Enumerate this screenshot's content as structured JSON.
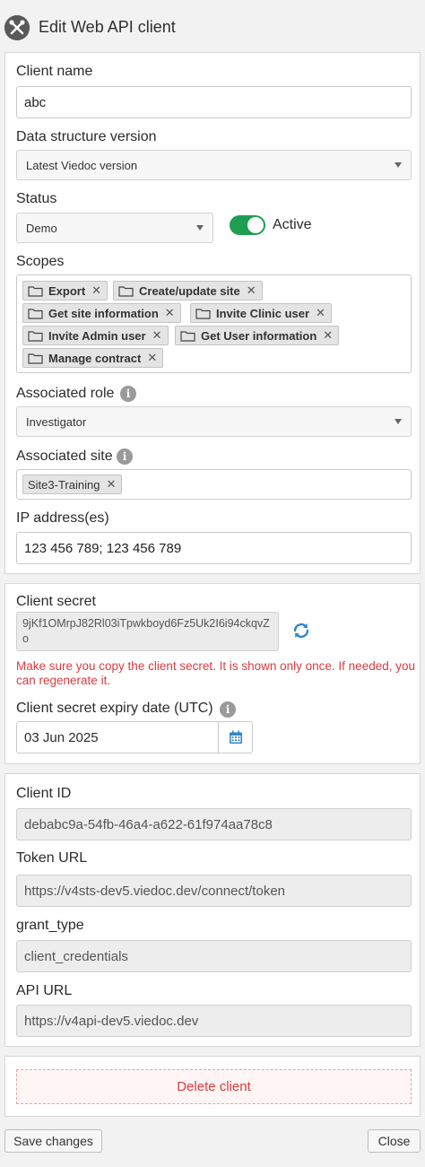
{
  "header": {
    "title": "Edit Web API client",
    "icon": "tools-icon"
  },
  "client_name": {
    "label": "Client name",
    "value": "abc"
  },
  "data_structure": {
    "label": "Data structure version",
    "value": "Latest Viedoc version"
  },
  "status": {
    "label": "Status",
    "value": "Demo",
    "toggle_label": "Active",
    "toggle_on": true
  },
  "scopes": {
    "label": "Scopes",
    "items": [
      "Export",
      "Create/update site",
      "Get site information",
      "Invite Clinic user",
      "Invite Admin user",
      "Get User information",
      "Manage contract"
    ]
  },
  "associated_role": {
    "label": "Associated role",
    "value": "Investigator"
  },
  "associated_site": {
    "label": "Associated site",
    "tag": "Site3-Training"
  },
  "ip": {
    "label": "IP address(es)",
    "value": "123 456 789; 123 456 789"
  },
  "secret": {
    "label": "Client secret",
    "value": "9jKf1OMrpJ82Rl03iTpwkboyd6Fz5Uk2I6i94ckqvZo",
    "warning": "Make sure you copy the client secret. It is shown only once. If needed, you can regenerate it.",
    "expiry_label": "Client secret expiry date (UTC)",
    "expiry_value": "03 Jun 2025"
  },
  "details": {
    "client_id_label": "Client ID",
    "client_id": "debabc9a-54fb-46a4-a622-61f974aa78c8",
    "token_url_label": "Token URL",
    "token_url": "https://v4sts-dev5.viedoc.dev/connect/token",
    "grant_type_label": "grant_type",
    "grant_type": "client_credentials",
    "api_url_label": "API URL",
    "api_url": "https://v4api-dev5.viedoc.dev"
  },
  "actions": {
    "delete": "Delete client",
    "save": "Save changes",
    "close": "Close"
  },
  "colors": {
    "accent_toggle": "#1e9e52",
    "warning": "#e0393e",
    "link_icon": "#2f86c9"
  }
}
